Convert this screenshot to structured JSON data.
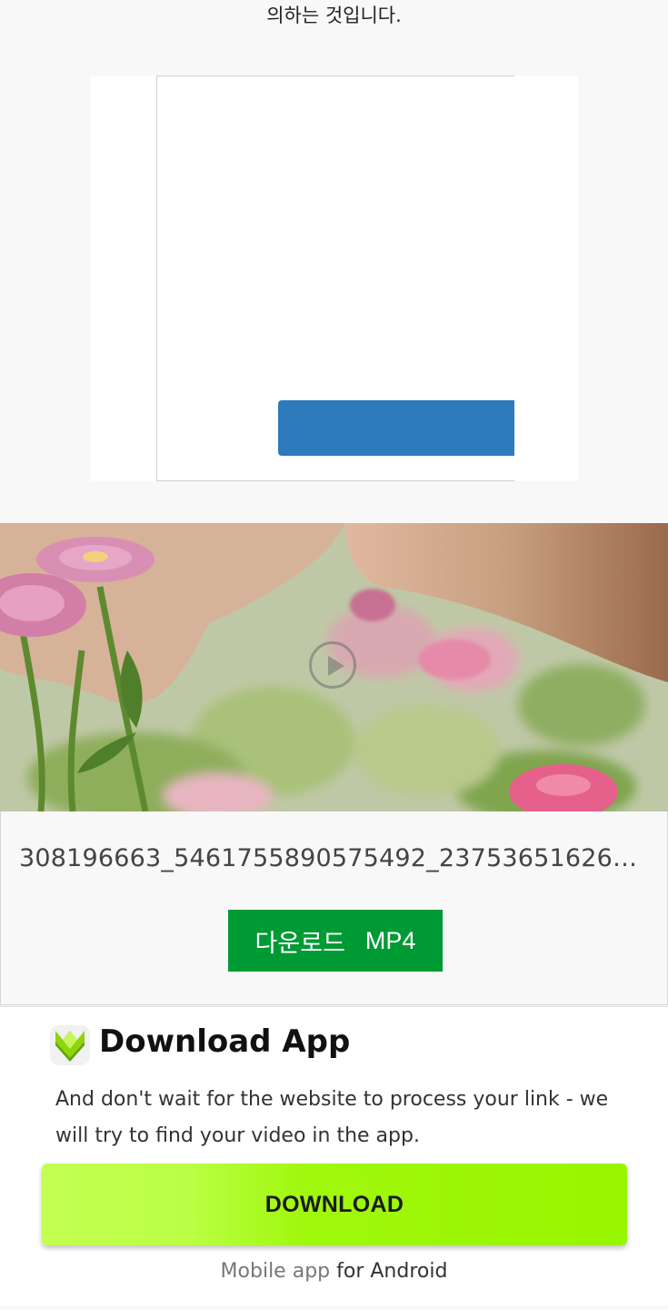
{
  "header": {
    "truncated_text": "의하는 것입니다."
  },
  "video": {
    "filename": "308196663_5461755890575492_2375365162633…",
    "download_label": "다운로드",
    "format": "MP4"
  },
  "app_promo": {
    "title": "Download App",
    "description": "And don't wait for the website to process your link - we will try to find your video in the app.",
    "button_label": "DOWNLOAD",
    "note_prefix": "Mobile app",
    "note_suffix": "for Android"
  },
  "colors": {
    "ad_button": "#2d7bbb",
    "mp4_button": "#009a35",
    "download_button": "#9cf700"
  },
  "icons": {
    "app_logo": "download-arrow-icon",
    "play": "play-icon"
  }
}
